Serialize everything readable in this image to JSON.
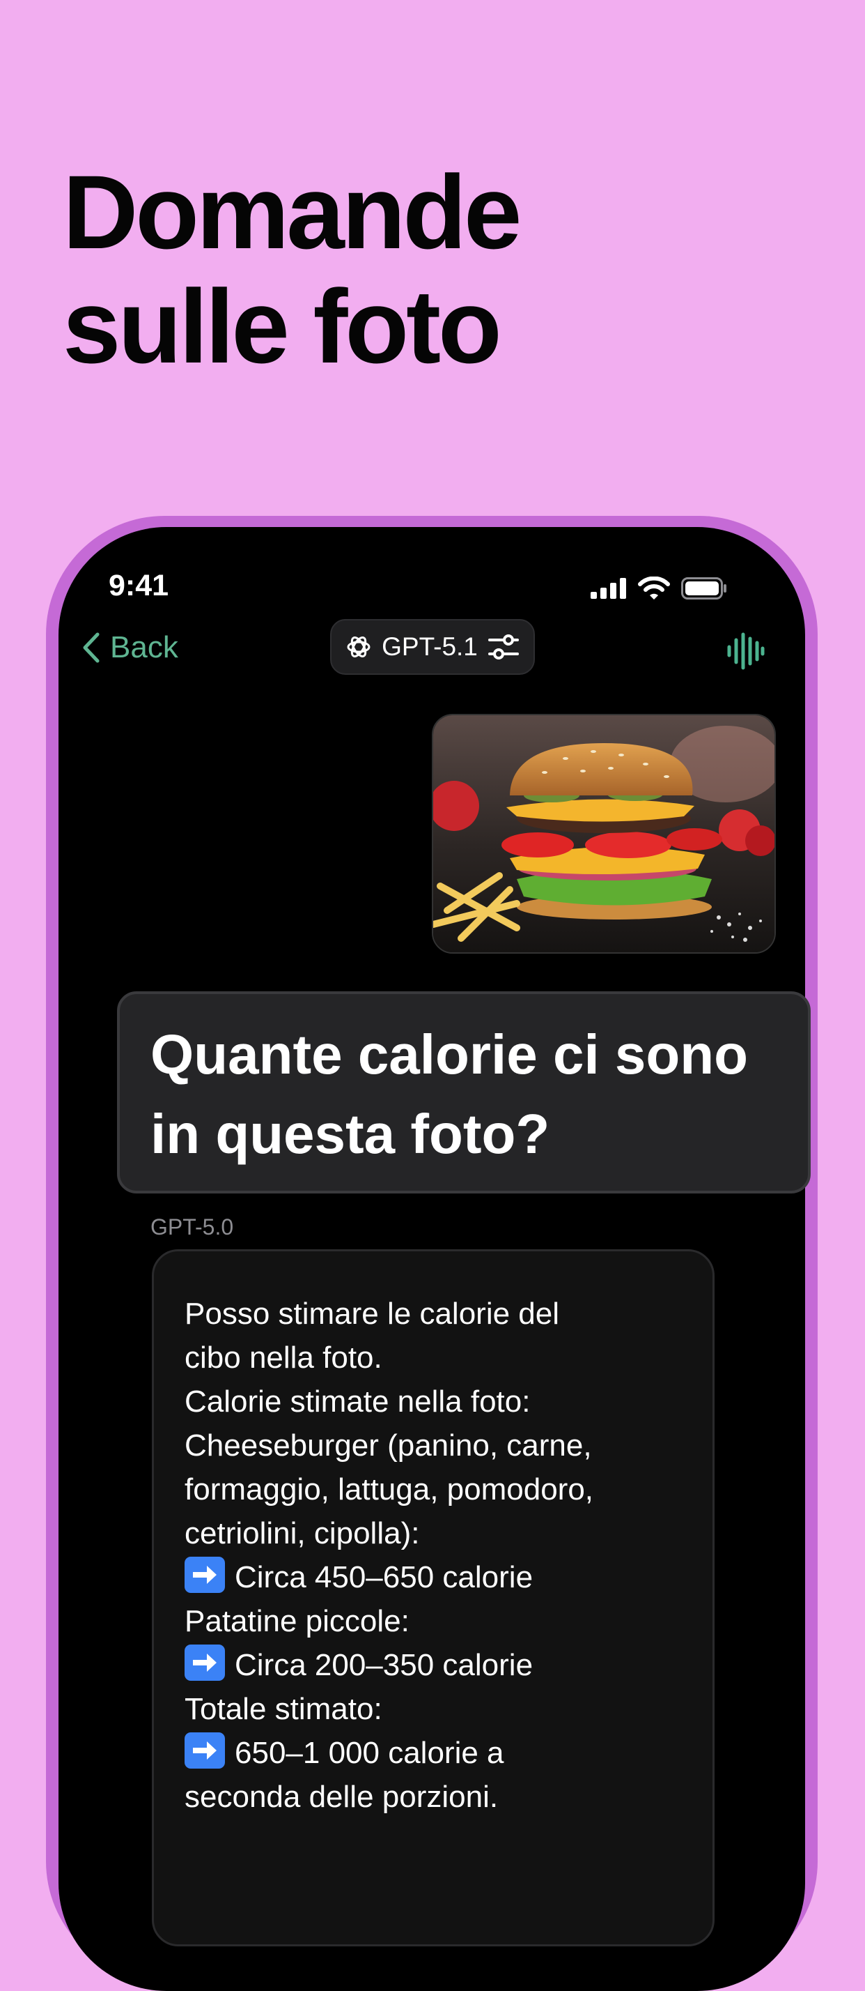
{
  "headline": {
    "line1": "Domande",
    "line2": "sulle foto"
  },
  "status_bar": {
    "time": "9:41"
  },
  "nav": {
    "back_label": "Back",
    "model_selector_label": "GPT-5.1"
  },
  "chat": {
    "user_question": "Quante calorie ci sono in questa foto?",
    "assistant_model": "GPT-5.0",
    "assistant_lines": [
      "Posso stimare le calorie del",
      "cibo nella foto.",
      "Calorie stimate nella foto:",
      "Cheeseburger (panino, carne,",
      "formaggio, lattuga, pomodoro,",
      "cetriolini, cipolla):",
      "Circa 450–650 calorie",
      "Patatine piccole:",
      "Circa 200–350 calorie",
      "Totale stimato:",
      "650–1 000 calorie a",
      "seconda delle porzioni."
    ]
  },
  "icons": {
    "back": "chevron-left-icon",
    "openai": "openai-logo-icon",
    "settings": "sliders-icon",
    "voice": "waveform-icon",
    "arrow": "right-arrow-emoji-icon"
  },
  "colors": {
    "background": "#f2aef0",
    "phone_frame": "#c56ad6",
    "accent_green": "#5fb592"
  }
}
